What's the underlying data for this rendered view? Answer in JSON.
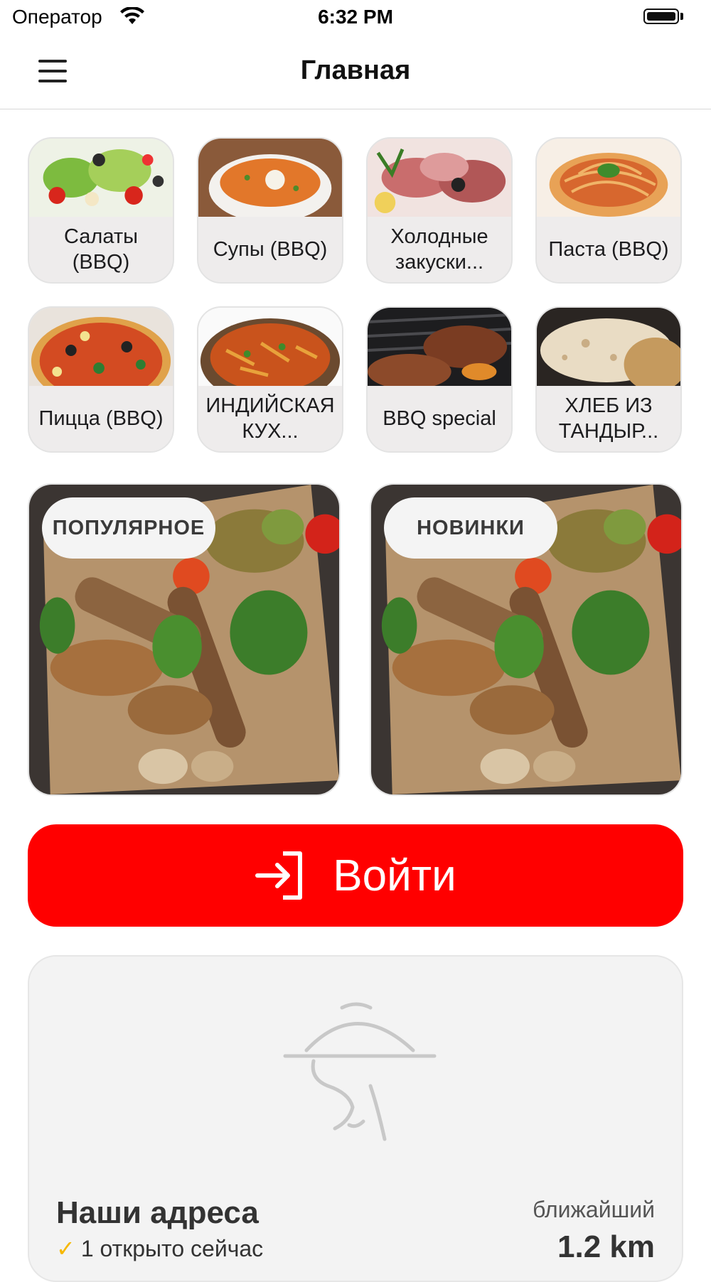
{
  "status_bar": {
    "carrier": "Оператор",
    "time": "6:32 PM",
    "battery_level": 1.0
  },
  "nav": {
    "title": "Главная",
    "menu_icon": "hamburger-menu-icon"
  },
  "categories": [
    {
      "label": "Салаты (BBQ)"
    },
    {
      "label": "Супы (BBQ)"
    },
    {
      "label": "Холодные закуски..."
    },
    {
      "label": "Паста (BBQ)"
    },
    {
      "label": "Пицца (BBQ)"
    },
    {
      "label": "ИНДИЙСКАЯ КУХ..."
    },
    {
      "label": "BBQ special"
    },
    {
      "label": "ХЛЕБ ИЗ ТАНДЫР..."
    }
  ],
  "promos": [
    {
      "label": "ПОПУЛЯРНОЕ"
    },
    {
      "label": "НОВИНКИ"
    }
  ],
  "login": {
    "label": "Войти",
    "icon": "login-arrow-icon",
    "color": "#ff0000"
  },
  "addresses": {
    "title": "Наши адреса",
    "open_now": "1 открыто сейчас",
    "nearest_label": "ближайший",
    "nearest_distance": "1.2 km",
    "logo_icon": "chef-cloche-icon"
  }
}
